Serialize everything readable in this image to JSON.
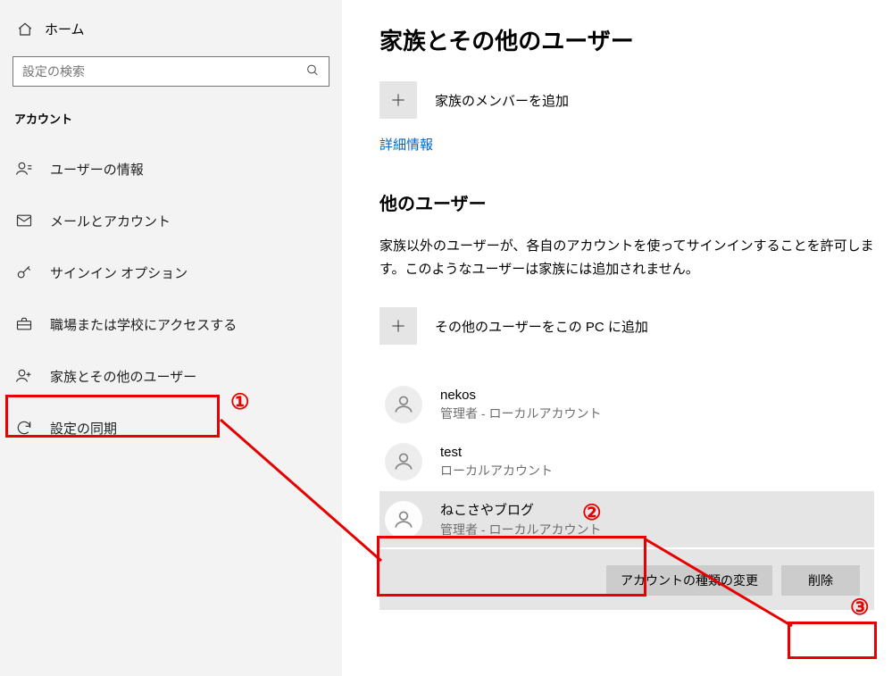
{
  "sidebar": {
    "home_label": "ホーム",
    "search_placeholder": "設定の検索",
    "category_title": "アカウント",
    "items": [
      {
        "label": "ユーザーの情報"
      },
      {
        "label": "メールとアカウント"
      },
      {
        "label": "サインイン オプション"
      },
      {
        "label": "職場または学校にアクセスする"
      },
      {
        "label": "家族とその他のユーザー"
      },
      {
        "label": "設定の同期"
      }
    ]
  },
  "main": {
    "page_title": "家族とその他のユーザー",
    "add_family_label": "家族のメンバーを追加",
    "more_info_label": "詳細情報",
    "other_users_title": "他のユーザー",
    "other_users_desc": "家族以外のユーザーが、各自のアカウントを使ってサインインすることを許可します。このようなユーザーは家族には追加されません。",
    "add_other_label": "その他のユーザーをこの PC に追加",
    "users": [
      {
        "name": "nekos",
        "role": "管理者 - ローカルアカウント"
      },
      {
        "name": "test",
        "role": "ローカルアカウント"
      },
      {
        "name": "ねこさやブログ",
        "role": "管理者 - ローカルアカウント"
      }
    ],
    "actions": {
      "change_type": "アカウントの種類の変更",
      "delete": "削除"
    }
  },
  "annotations": {
    "one": "①",
    "two": "②",
    "three": "③"
  }
}
